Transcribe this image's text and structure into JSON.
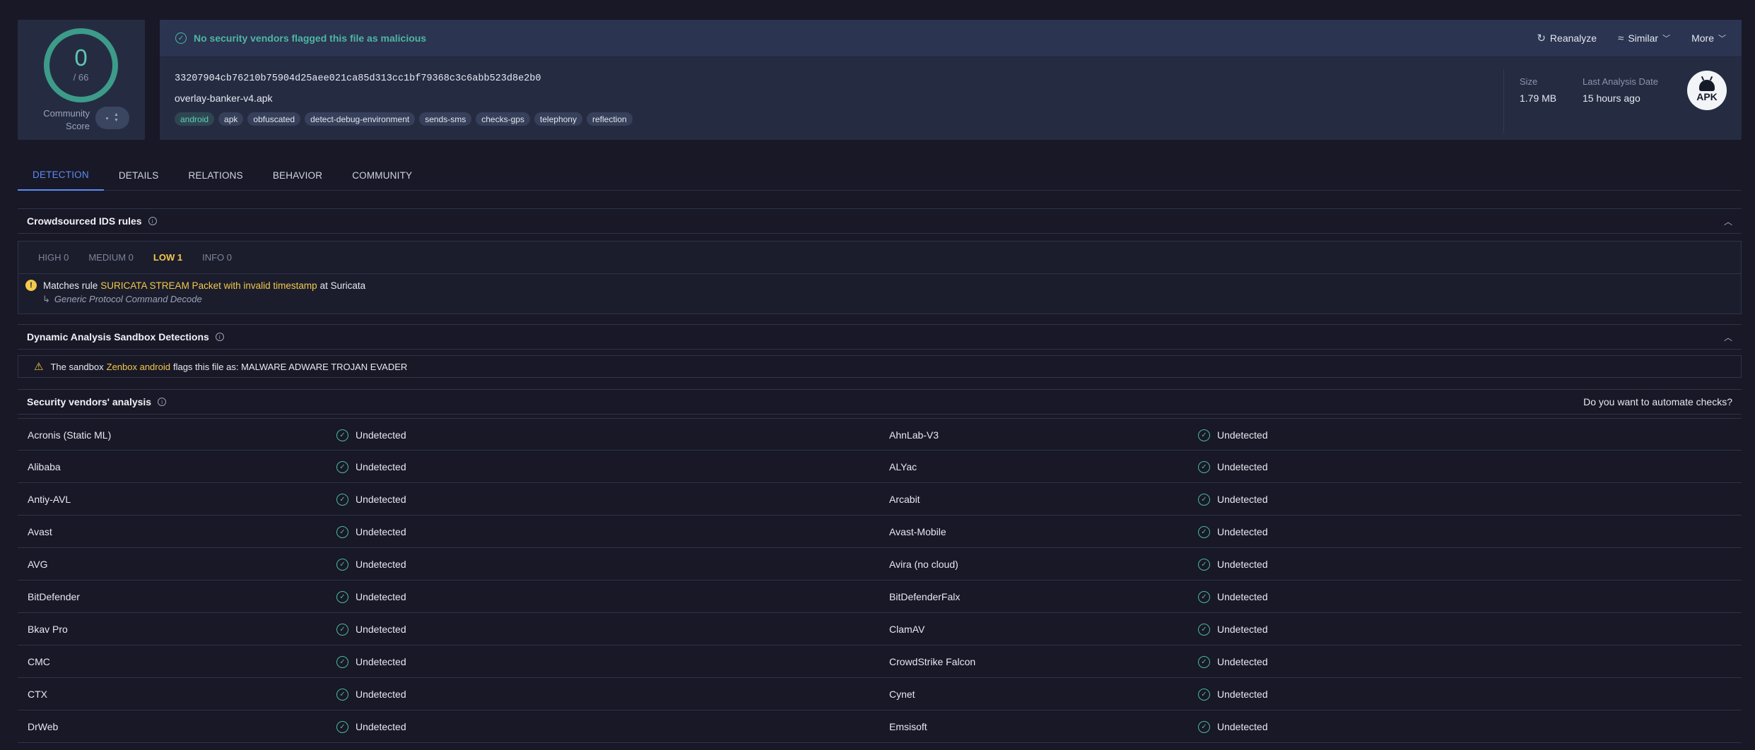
{
  "score": {
    "detections": "0",
    "total": "/ 66",
    "community_label": "Community Score",
    "community_value": "-"
  },
  "banner": {
    "status_text": "No security vendors flagged this file as malicious",
    "status_color": "#4fb6a3",
    "reanalyze_label": "Reanalyze",
    "similar_label": "Similar",
    "more_label": "More"
  },
  "file": {
    "hash": "33207904cb76210b75904d25aee021ca85d313cc1bf79368c3c6abb523d8e2b0",
    "name": "overlay-banker-v4.apk",
    "tags": [
      "android",
      "apk",
      "obfuscated",
      "detect-debug-environment",
      "sends-sms",
      "checks-gps",
      "telephony",
      "reflection"
    ],
    "size_label": "Size",
    "size_value": "1.79 MB",
    "last_analysis_label": "Last Analysis Date",
    "last_analysis_value": "15 hours ago",
    "type_icon_text": "APK"
  },
  "tabs": [
    "DETECTION",
    "DETAILS",
    "RELATIONS",
    "BEHAVIOR",
    "COMMUNITY"
  ],
  "ids": {
    "title": "Crowdsourced IDS rules",
    "severities": [
      "HIGH 0",
      "MEDIUM 0",
      "LOW 1",
      "INFO 0"
    ],
    "rule_prefix": "Matches rule",
    "rule_name": "SURICATA STREAM Packet with invalid timestamp",
    "rule_suffix": "at Suricata",
    "rule_category": "Generic Protocol Command Decode"
  },
  "sandbox": {
    "title": "Dynamic Analysis Sandbox Detections",
    "prefix": "The sandbox",
    "sandbox_name": "Zenbox android",
    "suffix": "flags this file as: MALWARE ADWARE TROJAN EVADER"
  },
  "vendors": {
    "title": "Security vendors' analysis",
    "automate_link": "Do you want to automate checks?",
    "rows": [
      {
        "left": "Acronis (Static ML)",
        "left_result": "Undetected",
        "right": "AhnLab-V3",
        "right_result": "Undetected"
      },
      {
        "left": "Alibaba",
        "left_result": "Undetected",
        "right": "ALYac",
        "right_result": "Undetected"
      },
      {
        "left": "Antiy-AVL",
        "left_result": "Undetected",
        "right": "Arcabit",
        "right_result": "Undetected"
      },
      {
        "left": "Avast",
        "left_result": "Undetected",
        "right": "Avast-Mobile",
        "right_result": "Undetected"
      },
      {
        "left": "AVG",
        "left_result": "Undetected",
        "right": "Avira (no cloud)",
        "right_result": "Undetected"
      },
      {
        "left": "BitDefender",
        "left_result": "Undetected",
        "right": "BitDefenderFalx",
        "right_result": "Undetected"
      },
      {
        "left": "Bkav Pro",
        "left_result": "Undetected",
        "right": "ClamAV",
        "right_result": "Undetected"
      },
      {
        "left": "CMC",
        "left_result": "Undetected",
        "right": "CrowdStrike Falcon",
        "right_result": "Undetected"
      },
      {
        "left": "CTX",
        "left_result": "Undetected",
        "right": "Cynet",
        "right_result": "Undetected"
      },
      {
        "left": "DrWeb",
        "left_result": "Undetected",
        "right": "Emsisoft",
        "right_result": "Undetected"
      }
    ]
  }
}
